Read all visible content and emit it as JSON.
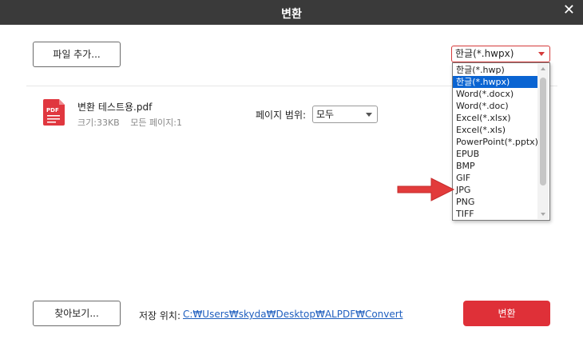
{
  "window": {
    "title": "변환",
    "close_symbol": "✕"
  },
  "toolbar": {
    "add_file_label": "파일 추가..."
  },
  "format": {
    "selected": "한글(*.hwpx)",
    "options": [
      "한글(*.hwp)",
      "한글(*.hwpx)",
      "Word(*.docx)",
      "Word(*.doc)",
      "Excel(*.xlsx)",
      "Excel(*.xls)",
      "PowerPoint(*.pptx)",
      "EPUB",
      "BMP",
      "GIF",
      "JPG",
      "PNG",
      "TIFF"
    ],
    "highlighted_option": "한글(*.hwpx)",
    "accent": "#d43a3a"
  },
  "file": {
    "name": "변환 테스트용.pdf",
    "size": "크기:33KB",
    "pages": "모든 페이지:1",
    "icon": "pdf-file-icon",
    "icon_text": "PDF"
  },
  "page_range": {
    "label": "페이지 범위:",
    "value": "모두"
  },
  "footer": {
    "browse_label": "찾아보기...",
    "save_location_label": "저장 위치:",
    "save_path": "C:₩Users₩skyda₩Desktop₩ALPDF₩Convert",
    "convert_label": "변환",
    "convert_color": "#df3038"
  },
  "annotation": {
    "arrow_color": "#e23b3b",
    "arrow_points_to": "JPG"
  },
  "colors": {
    "titlebar": "#3a3a3a",
    "selection": "#0a64d2",
    "link": "#1f5fbf"
  }
}
